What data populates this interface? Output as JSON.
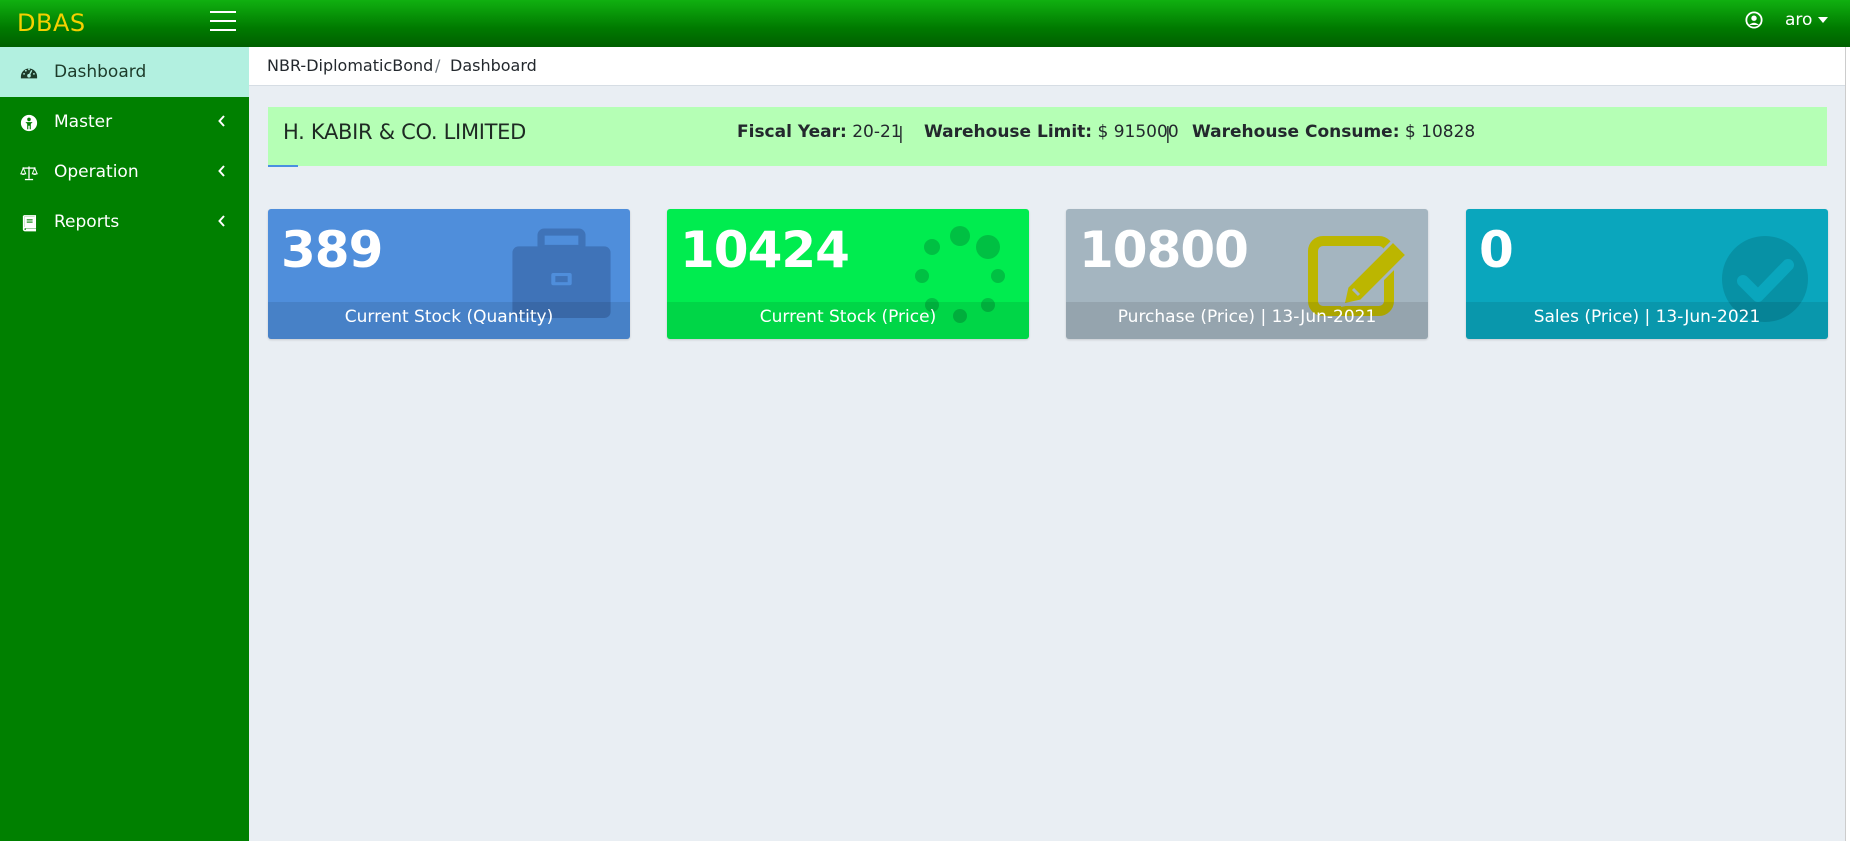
{
  "header": {
    "brand": "DBAS",
    "user": "aro"
  },
  "sidebar": {
    "items": [
      {
        "label": "Dashboard",
        "icon": "dashboard-icon",
        "active": true
      },
      {
        "label": "Master",
        "icon": "user-circle-icon"
      },
      {
        "label": "Operation",
        "icon": "balance-scale-icon"
      },
      {
        "label": "Reports",
        "icon": "book-icon"
      }
    ]
  },
  "breadcrumb": {
    "root": "NBR-DiplomaticBond",
    "sep": "/",
    "current": "Dashboard"
  },
  "company": {
    "name": "H. KABIR & CO. LIMITED",
    "fiscal_label": "Fiscal Year:",
    "fiscal_value": "20-21",
    "limit_label": "Warehouse Limit:",
    "limit_value": "$ 915000",
    "consume_label": "Warehouse Consume:",
    "consume_value": "$ 10828",
    "separator": "|"
  },
  "cards": [
    {
      "value": "389",
      "label": "Current Stock (Quantity)",
      "color": "#4f8edb",
      "icon": "briefcase-icon"
    },
    {
      "value": "10424",
      "label": "Current Stock (Price)",
      "color": "#00ec4f",
      "icon": "spinner-icon"
    },
    {
      "value": "10800",
      "label": "Purchase (Price) | 13-Jun-2021",
      "color": "#a4b5c0",
      "icon": "edit-icon"
    },
    {
      "value": "0",
      "label": "Sales (Price) | 13-Jun-2021",
      "color": "#0aa6bd",
      "icon": "check-circle-icon"
    }
  ]
}
